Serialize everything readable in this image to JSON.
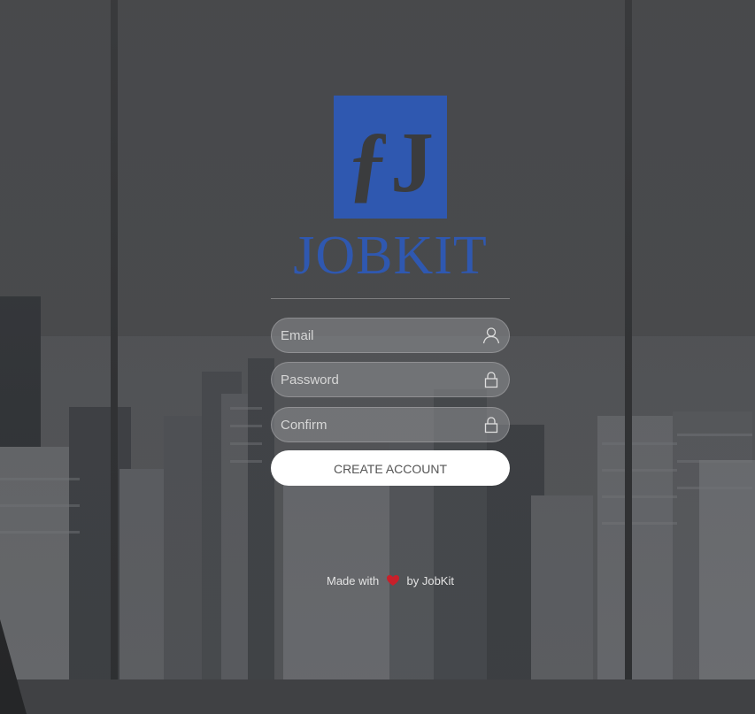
{
  "brand": {
    "logo_mark": "ƒJ",
    "name": "JOBKIT",
    "color": "#2f58b0"
  },
  "form": {
    "email": {
      "placeholder": "Email",
      "value": "",
      "icon": "user-icon"
    },
    "password": {
      "placeholder": "Password",
      "value": "",
      "icon": "lock-icon"
    },
    "confirm": {
      "placeholder": "Confirm",
      "value": "",
      "icon": "lock-icon"
    },
    "submit_label": "CREATE ACCOUNT"
  },
  "footer": {
    "made_with": "Made with",
    "by": "by JobKit",
    "icon": "heart-icon",
    "heart_color": "#c8202a"
  }
}
